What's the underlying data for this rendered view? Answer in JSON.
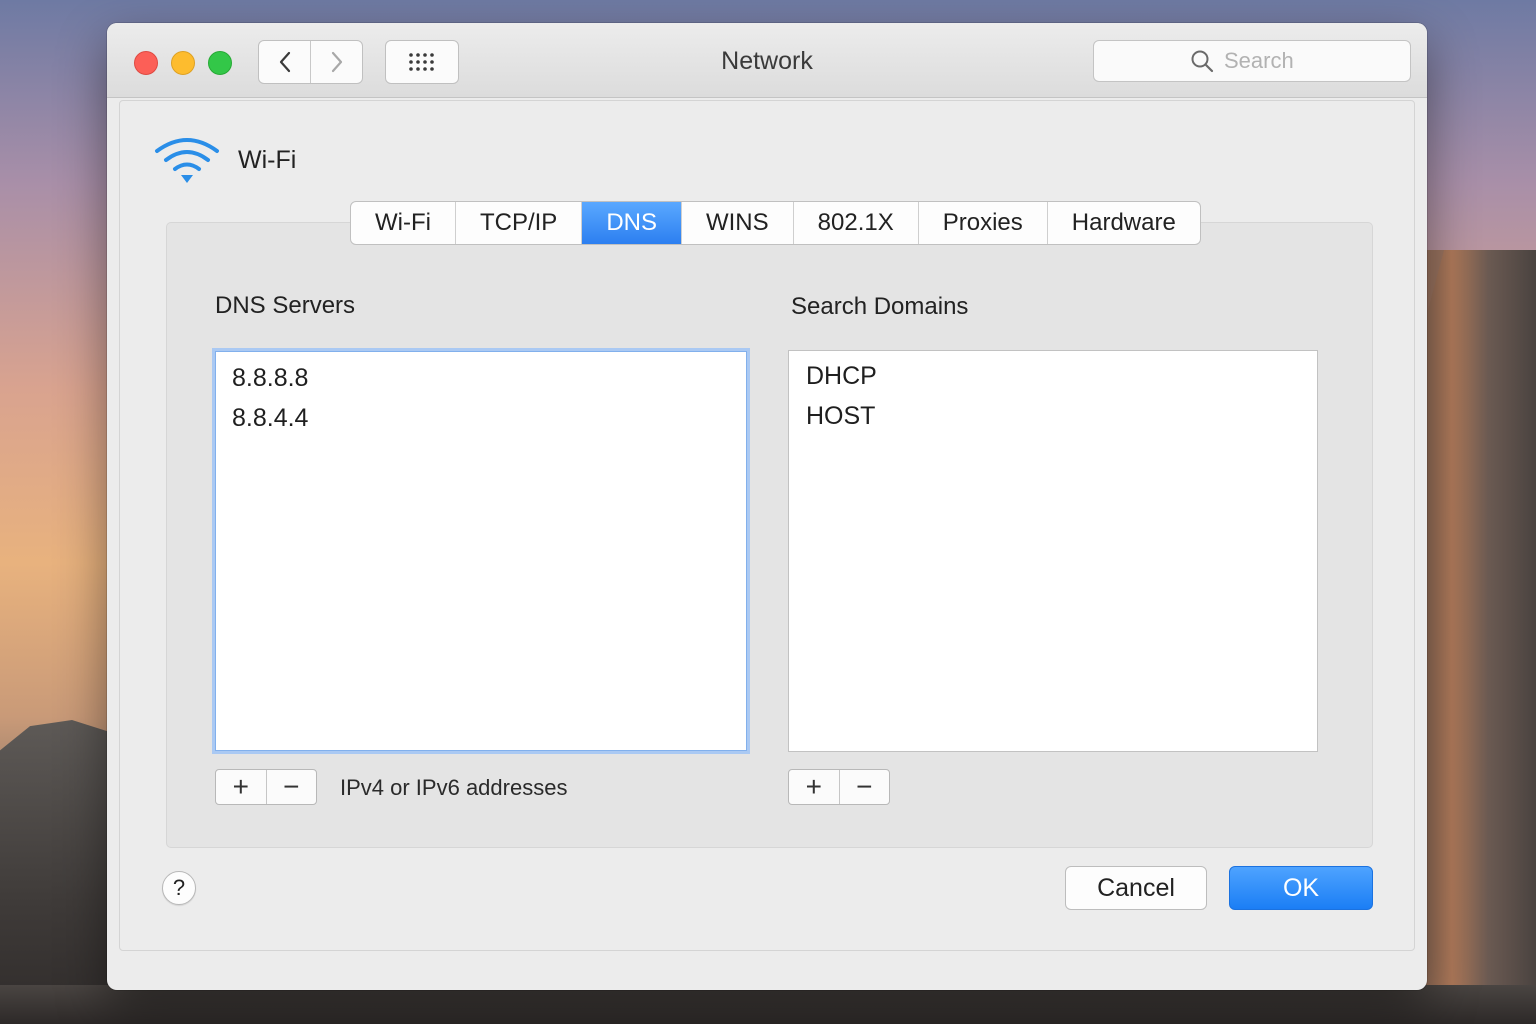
{
  "window": {
    "title": "Network",
    "search": {
      "placeholder": "Search",
      "value": ""
    }
  },
  "interface": {
    "name": "Wi-Fi",
    "icon": "wifi-icon"
  },
  "tabs": [
    {
      "label": "Wi-Fi",
      "active": false
    },
    {
      "label": "TCP/IP",
      "active": false
    },
    {
      "label": "DNS",
      "active": true
    },
    {
      "label": "WINS",
      "active": false
    },
    {
      "label": "802.1X",
      "active": false
    },
    {
      "label": "Proxies",
      "active": false
    },
    {
      "label": "Hardware",
      "active": false
    }
  ],
  "dns_servers": {
    "label": "DNS Servers",
    "items": [
      "8.8.8.8",
      "8.8.4.4"
    ],
    "add": "+",
    "remove": "−",
    "hint": "IPv4 or IPv6  addresses"
  },
  "search_domains": {
    "label": "Search Domains",
    "items": [
      "DHCP",
      "HOST"
    ],
    "add": "+",
    "remove": "−"
  },
  "footer": {
    "help": "?",
    "cancel": "Cancel",
    "ok": "OK"
  },
  "colors": {
    "accent": "#2c7ff0",
    "close": "#fc5f57",
    "minimize": "#fdbc2e",
    "zoom": "#33c748",
    "wifi": "#2a8ee8"
  }
}
